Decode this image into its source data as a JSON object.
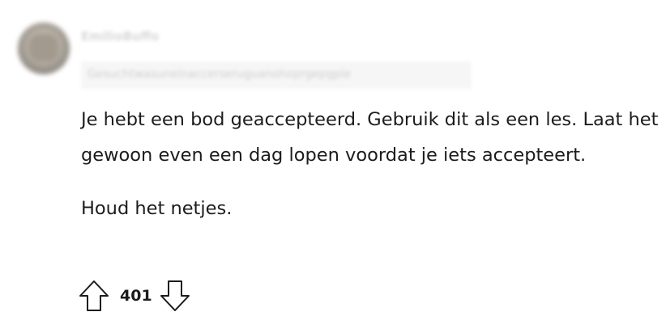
{
  "comment": {
    "author": {
      "username": "EmilioBuffo",
      "flair": "Gesuchtwasuneinaccerseruguanohoprgepgple"
    },
    "body": {
      "paragraphs": [
        "Je hebt een bod geaccepteerd. Gebruik dit als een les. Laat het gewoon even een dag lopen voordat je iets accepteert.",
        "Houd het netjes."
      ]
    },
    "votes": {
      "score": "401",
      "upvote_icon": "arrow-up-outline-icon",
      "downvote_icon": "arrow-down-outline-icon"
    }
  },
  "colors": {
    "text": "#1c1c1c",
    "icon": "#1c1c1c",
    "background": "#ffffff"
  }
}
